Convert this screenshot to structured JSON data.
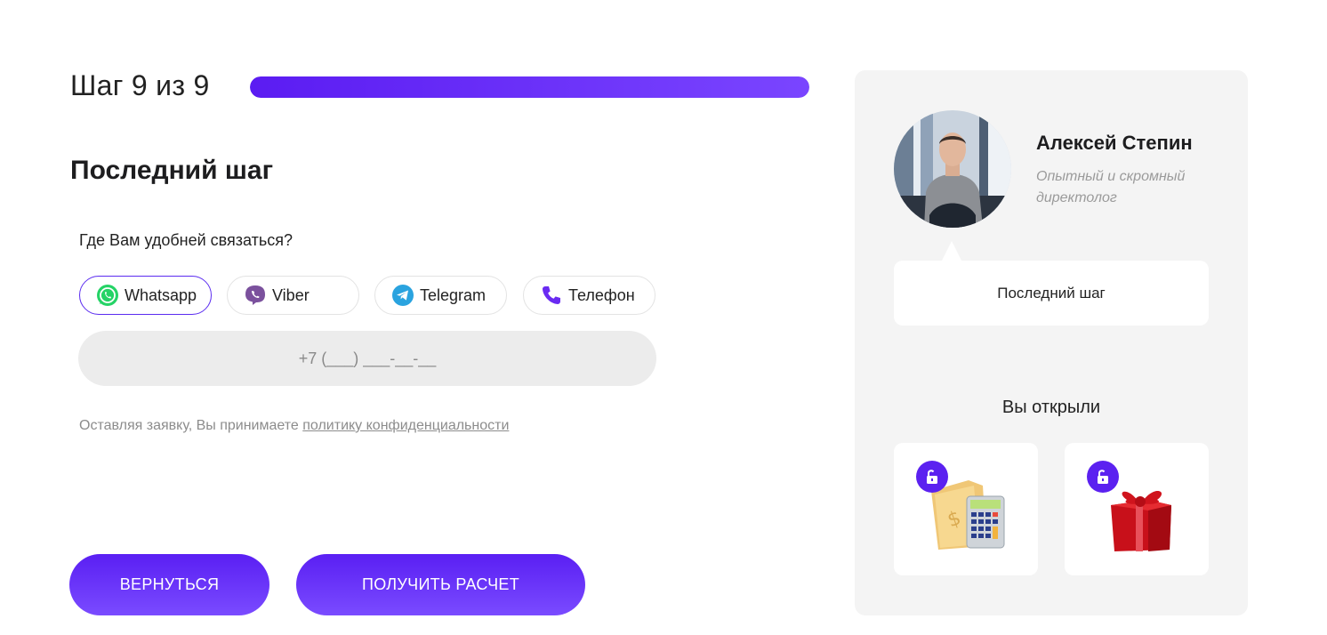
{
  "step": {
    "label": "Шаг 9 из 9",
    "progress_fraction": 1.0
  },
  "title": "Последний шаг",
  "question": "Где Вам удобней связаться?",
  "messengers": [
    {
      "label": "Whatsapp",
      "icon": "whatsapp-icon",
      "selected": true
    },
    {
      "label": "Viber",
      "icon": "viber-icon",
      "selected": false
    },
    {
      "label": "Telegram",
      "icon": "telegram-icon",
      "selected": false
    },
    {
      "label": "Телефон",
      "icon": "phone-icon",
      "selected": false
    }
  ],
  "phone_input": {
    "placeholder": "+7 (___) ___-__-__",
    "value": ""
  },
  "policy": {
    "text": "Оставляя заявку, Вы принимаете ",
    "link": "политику конфиденциальности"
  },
  "buttons": {
    "back": "ВЕРНУТЬСЯ",
    "submit": "ПОЛУЧИТЬ РАСЧЕТ"
  },
  "manager": {
    "name": "Алексей Степин",
    "role": "Опытный и скромный директолог",
    "message": "Последний шаг"
  },
  "bonuses": {
    "title": "Вы открыли",
    "items": [
      {
        "icon": "calculator-folder-icon",
        "lock_icon": "unlock-icon"
      },
      {
        "icon": "gift-box-icon",
        "lock_icon": "unlock-icon"
      }
    ]
  },
  "colors": {
    "accent": "#5b21f0",
    "accent_light": "#7a4bff",
    "panel_bg": "#f4f4f4",
    "input_bg": "#ececec"
  }
}
